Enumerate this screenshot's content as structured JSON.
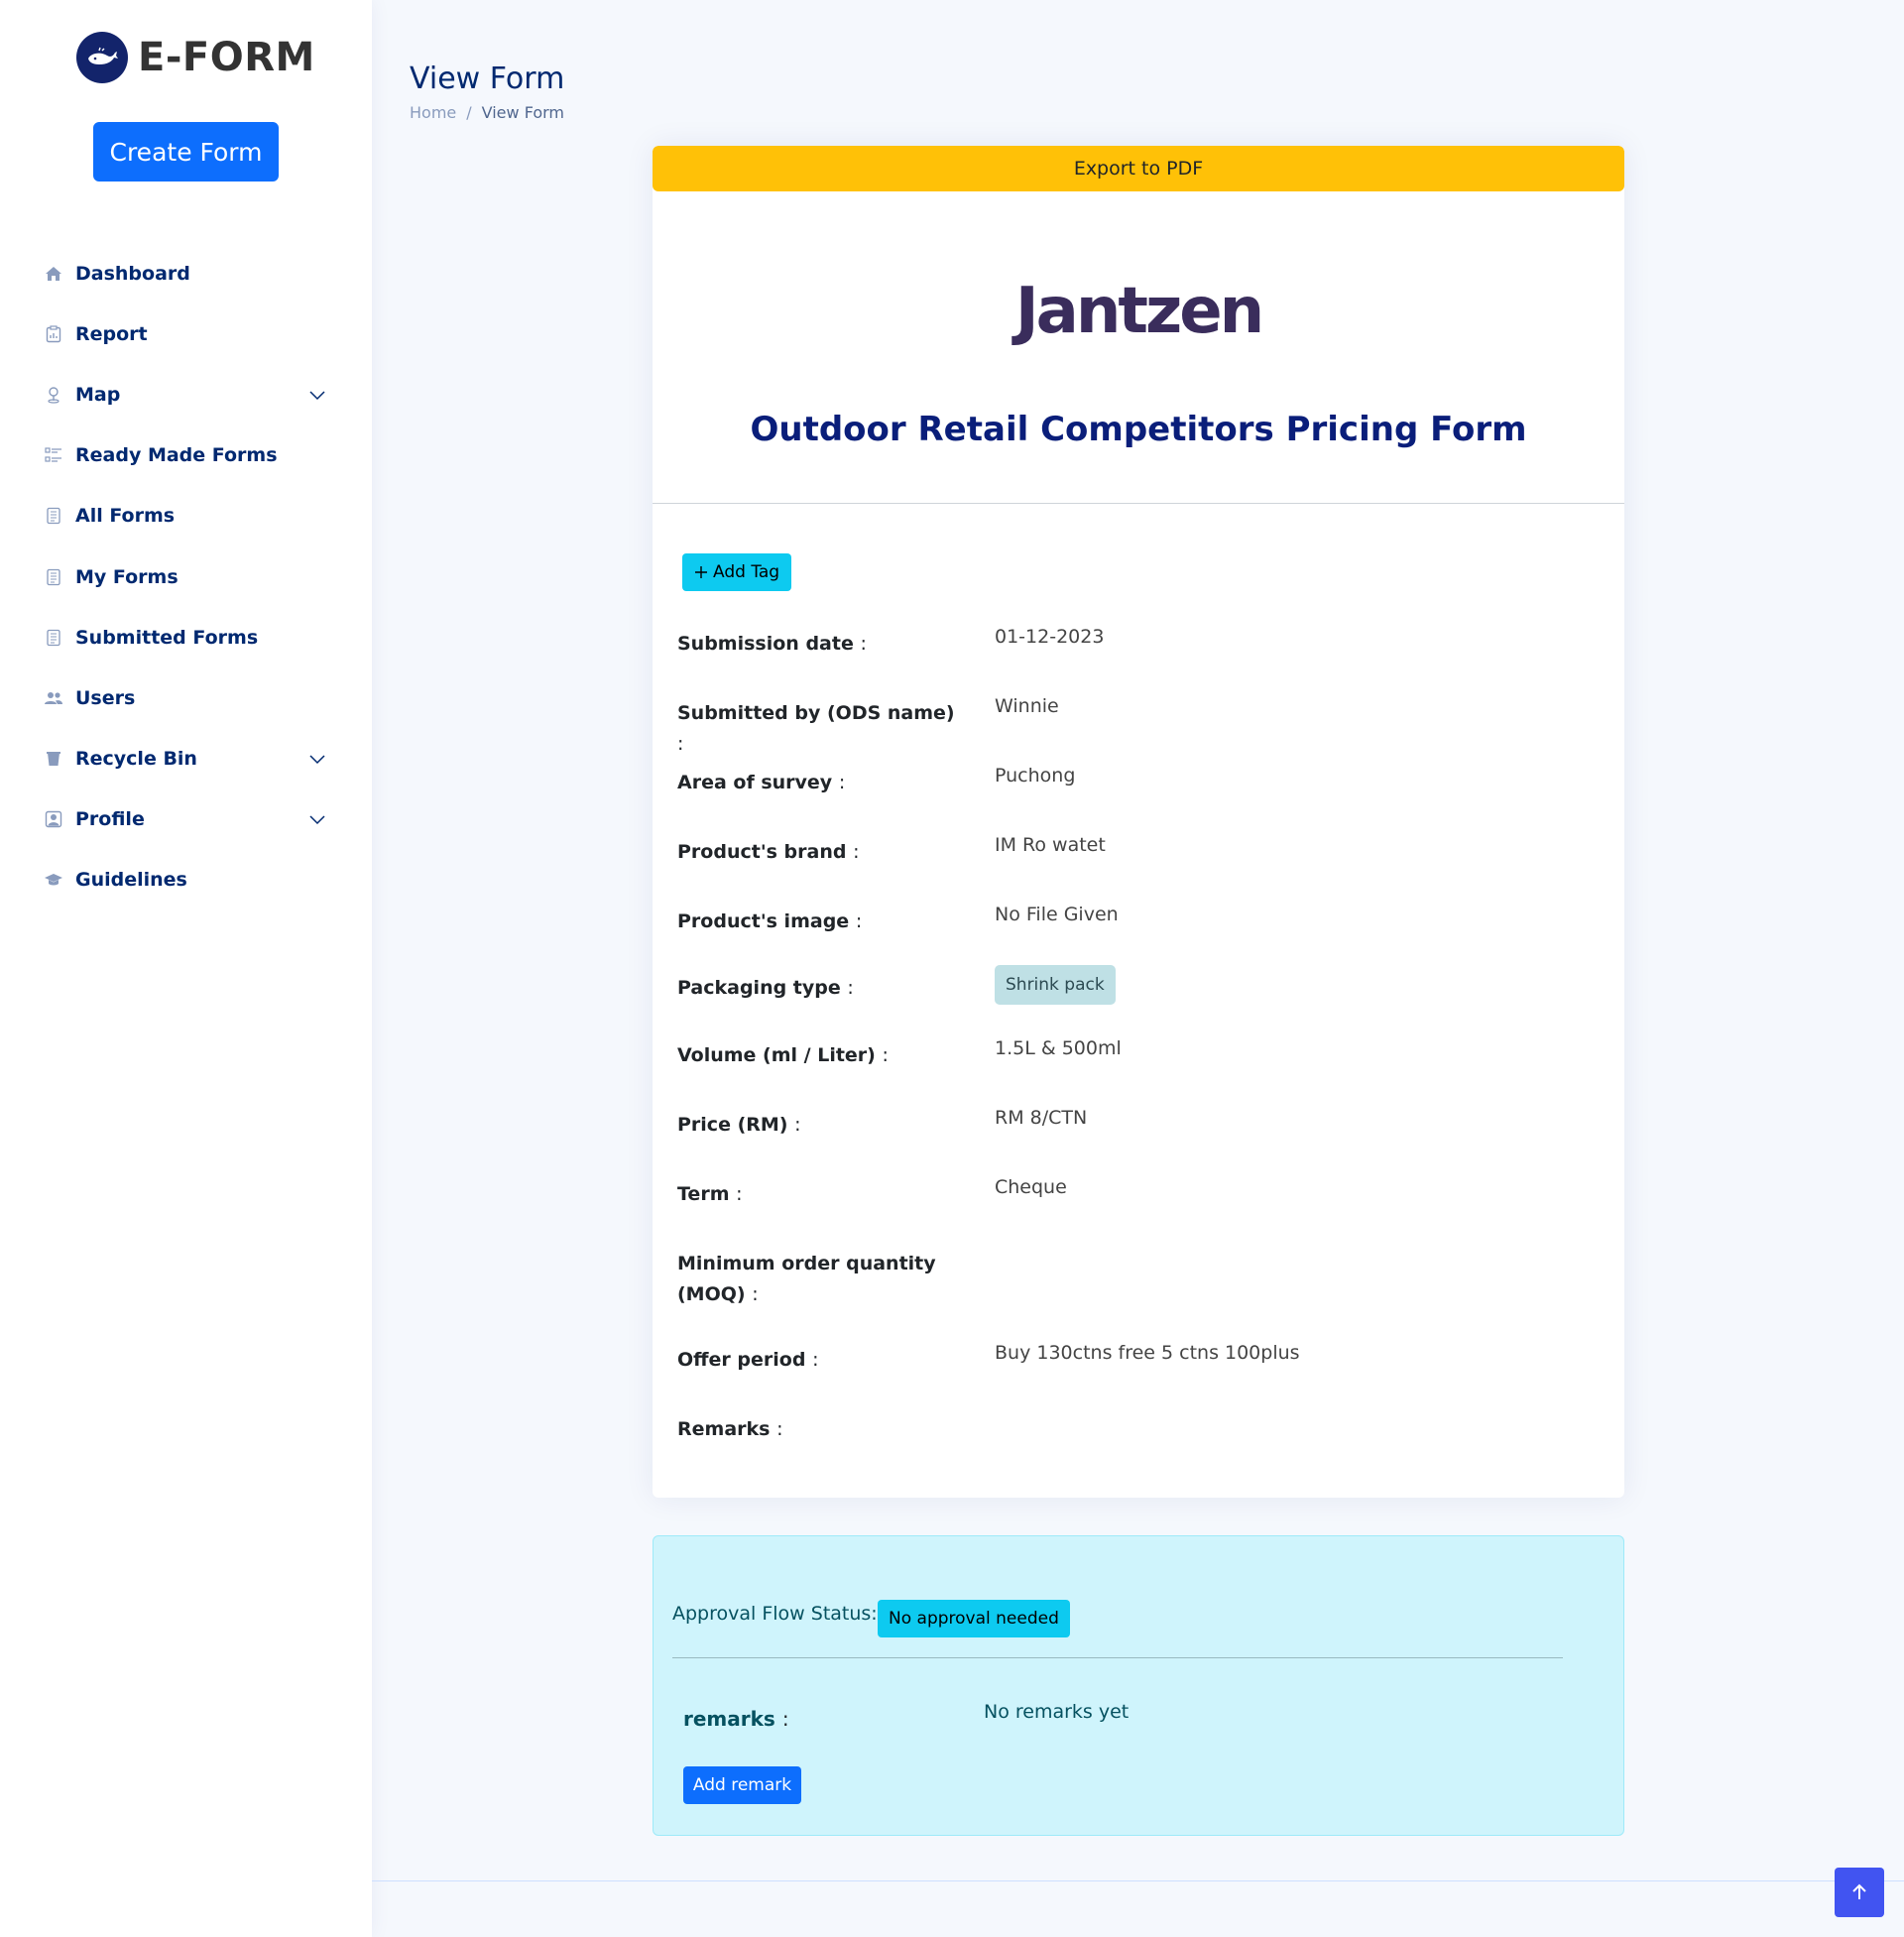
{
  "brand": {
    "name": "E-FORM",
    "logo_icon": "whale-logo-icon",
    "logo_bg": "#13246b"
  },
  "sidebar": {
    "create_label": "Create Form",
    "items": [
      {
        "label": "Dashboard",
        "icon": "house-icon",
        "expandable": false
      },
      {
        "label": "Report",
        "icon": "clipboard-icon",
        "expandable": false
      },
      {
        "label": "Map",
        "icon": "pin-icon",
        "expandable": true
      },
      {
        "label": "Ready Made Forms",
        "icon": "list-icon",
        "expandable": false
      },
      {
        "label": "All Forms",
        "icon": "document-icon",
        "expandable": false
      },
      {
        "label": "My Forms",
        "icon": "document-icon",
        "expandable": false
      },
      {
        "label": "Submitted Forms",
        "icon": "document-icon",
        "expandable": false
      },
      {
        "label": "Users",
        "icon": "people-icon",
        "expandable": false
      },
      {
        "label": "Recycle Bin",
        "icon": "trash-icon",
        "expandable": true
      },
      {
        "label": "Profile",
        "icon": "person-badge-icon",
        "expandable": true
      },
      {
        "label": "Guidelines",
        "icon": "mortarboard-icon",
        "expandable": false
      }
    ]
  },
  "page": {
    "title": "View Form",
    "breadcrumb": {
      "home": "Home",
      "separator": "/",
      "current": "View Form"
    }
  },
  "form": {
    "export_label": "Export to PDF",
    "company_logo_text": "Jantzen",
    "title": "Outdoor Retail Competitors Pricing Form",
    "add_tag_label": "Add Tag",
    "colon": ":",
    "fields": {
      "submission_date": {
        "label": "Submission date",
        "value": "01-12-2023"
      },
      "submitted_by": {
        "label": "Submitted by (ODS name)",
        "value": "Winnie"
      },
      "area": {
        "label": "Area of survey",
        "value": "Puchong"
      },
      "brand": {
        "label": "Product's brand",
        "value": "IM Ro watet"
      },
      "image": {
        "label": "Product's image",
        "value": "No File Given"
      },
      "packaging": {
        "label": "Packaging type",
        "value": "Shrink pack"
      },
      "volume": {
        "label": "Volume (ml / Liter)",
        "value": "1.5L & 500ml"
      },
      "price": {
        "label": "Price (RM)",
        "value": "RM 8/CTN"
      },
      "term": {
        "label": "Term",
        "value": "Cheque"
      },
      "moq": {
        "label": "Minimum order quantity (MOQ)",
        "value": ""
      },
      "offer": {
        "label": "Offer period",
        "value": "Buy 130ctns free 5 ctns 100plus"
      },
      "remarks": {
        "label": "Remarks",
        "value": ""
      }
    }
  },
  "approval": {
    "status_label": "Approval Flow Status:",
    "status_value": "No approval needed",
    "remarks_label": "remarks",
    "remarks_value": "No remarks yet",
    "add_remark_label": "Add remark"
  },
  "colors": {
    "accent": "#0d6efd",
    "nav_text": "#012970",
    "export": "#ffc107",
    "info": "#0dcaf0",
    "back_to_top": "#4154f1"
  }
}
